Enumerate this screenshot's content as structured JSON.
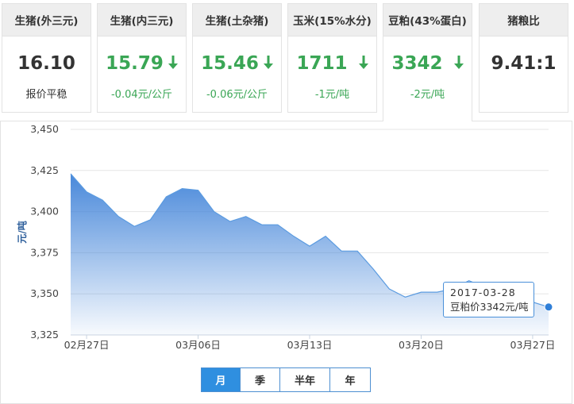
{
  "cards": [
    {
      "title": "生猪(外三元)",
      "price": "16.10",
      "trend": "flat",
      "sub": "报价平稳"
    },
    {
      "title": "生猪(内三元)",
      "price": "15.79",
      "trend": "down",
      "sub": "-0.04元/公斤"
    },
    {
      "title": "生猪(土杂猪)",
      "price": "15.46",
      "trend": "down",
      "sub": "-0.06元/公斤"
    },
    {
      "title": "玉米(15%水分)",
      "price": "1711",
      "trend": "down",
      "sub": "-1元/吨"
    },
    {
      "title": "豆粕(43%蛋白)",
      "price": "3342",
      "trend": "down",
      "sub": "-2元/吨",
      "active": true
    },
    {
      "title": "猪粮比",
      "price": "9.41:1",
      "trend": "none",
      "sub": ""
    }
  ],
  "colors": {
    "down": "#3aa655",
    "accent": "#2f8fe0",
    "line": "#5b9be0"
  },
  "chart_data": {
    "type": "area",
    "ylabel": "元/吨",
    "ylim": [
      3325,
      3450
    ],
    "yticks": [
      "3,325",
      "3,350",
      "3,375",
      "3,400",
      "3,425",
      "3,450"
    ],
    "ytick_values": [
      3325,
      3350,
      3375,
      3400,
      3425,
      3450
    ],
    "x": [
      "2017-02-26",
      "2017-02-27",
      "2017-02-28",
      "2017-03-01",
      "2017-03-02",
      "2017-03-03",
      "2017-03-04",
      "2017-03-05",
      "2017-03-06",
      "2017-03-07",
      "2017-03-08",
      "2017-03-09",
      "2017-03-10",
      "2017-03-11",
      "2017-03-12",
      "2017-03-13",
      "2017-03-14",
      "2017-03-15",
      "2017-03-16",
      "2017-03-17",
      "2017-03-18",
      "2017-03-19",
      "2017-03-20",
      "2017-03-21",
      "2017-03-22",
      "2017-03-23",
      "2017-03-24",
      "2017-03-25",
      "2017-03-26",
      "2017-03-27",
      "2017-03-28"
    ],
    "values": [
      3423,
      3412,
      3407,
      3397,
      3391,
      3395,
      3409,
      3414,
      3413,
      3400,
      3394,
      3397,
      3392,
      3392,
      3385,
      3379,
      3385,
      3376,
      3376,
      3365,
      3353,
      3348,
      3351,
      3351,
      3353,
      3358,
      3354,
      3351,
      3350,
      3345,
      3342
    ],
    "xtick_labels": [
      "02月27日",
      "03月06日",
      "03月13日",
      "03月20日",
      "03月27日"
    ],
    "xtick_index": [
      1,
      8,
      15,
      22,
      29
    ],
    "grid": true,
    "legend": "none",
    "highlight_index": 30
  },
  "tooltip": {
    "date": "2017-03-28",
    "text": "豆粕价3342元/吨"
  },
  "range": {
    "labels": [
      "月",
      "季",
      "半年",
      "年"
    ],
    "active": 0
  }
}
